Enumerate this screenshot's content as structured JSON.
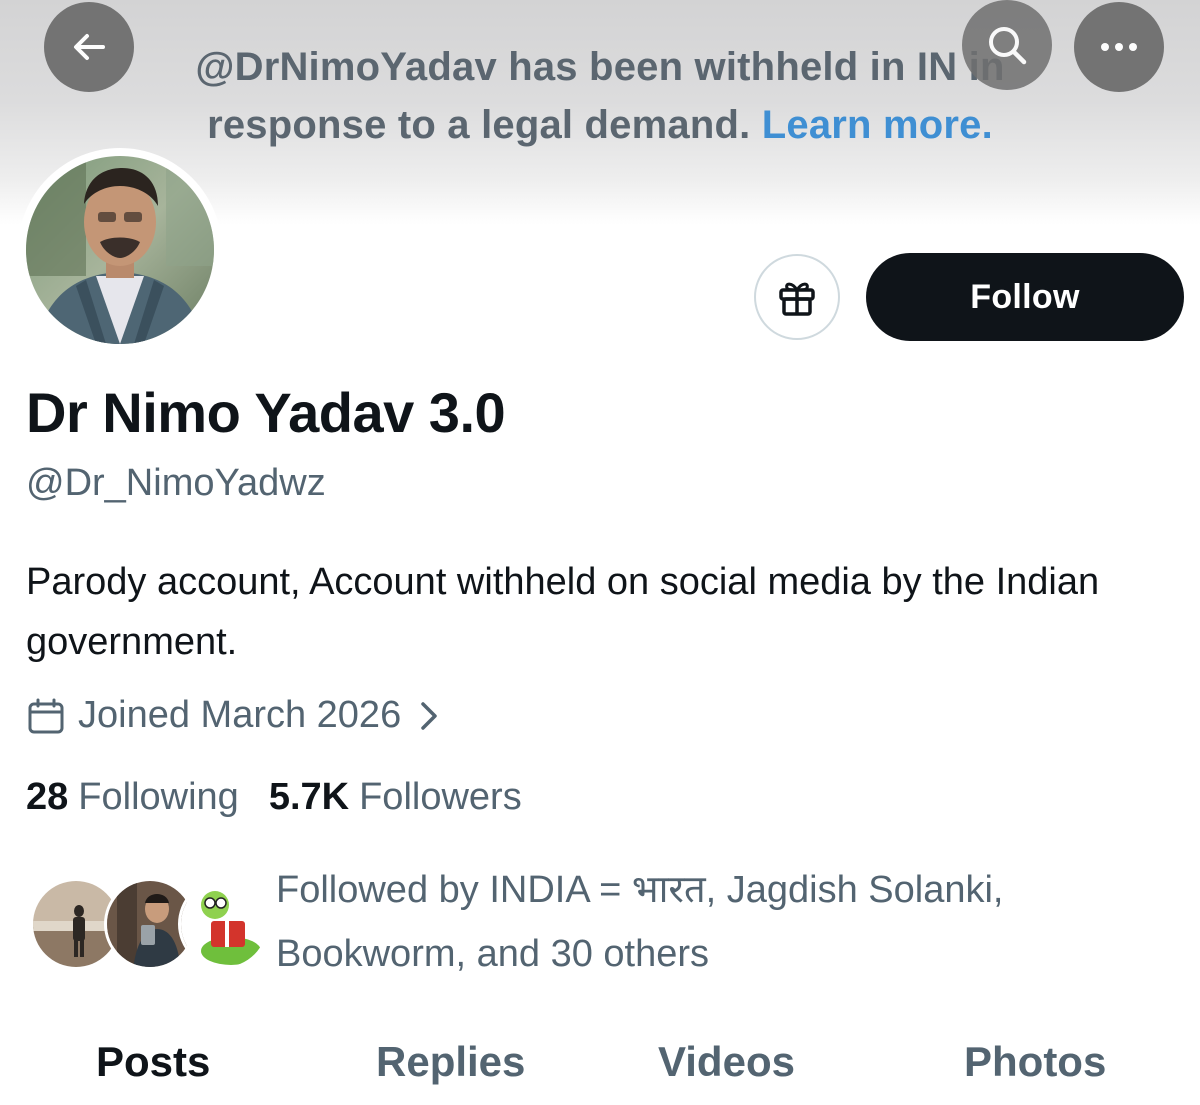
{
  "banner": {
    "line1": "@DrNimoYadav has been withheld in IN in",
    "line2": "response to a legal demand.",
    "link": "Learn more."
  },
  "profile": {
    "display_name": "Dr Nimo Yadav 3.0",
    "handle": "@Dr_NimoYadwz",
    "bio": "Parody account, Account withheld on social media by the Indian government.",
    "joined": "Joined March 2026"
  },
  "actions": {
    "follow_label": "Follow"
  },
  "stats": {
    "following_count": "28",
    "following_label": "Following",
    "followers_count": "5.7K",
    "followers_label": "Followers"
  },
  "followed_by": {
    "line1": "Followed by INDIA = भारत, Jagdish Solanki,",
    "line2": "Bookworm, and 30 others"
  },
  "tabs": [
    {
      "label": "Posts",
      "active": true
    },
    {
      "label": "Replies",
      "active": false
    },
    {
      "label": "Videos",
      "active": false
    },
    {
      "label": "Photos",
      "active": false
    }
  ],
  "icons": {
    "back": "arrow-left-icon",
    "search": "search-icon",
    "more": "more-dots-icon",
    "gift": "gift-icon",
    "calendar": "calendar-icon",
    "chevron": "chevron-right-icon"
  },
  "colors": {
    "link": "#3f8fd3",
    "follow_bg": "#0f1419",
    "muted_text": "#536471"
  }
}
